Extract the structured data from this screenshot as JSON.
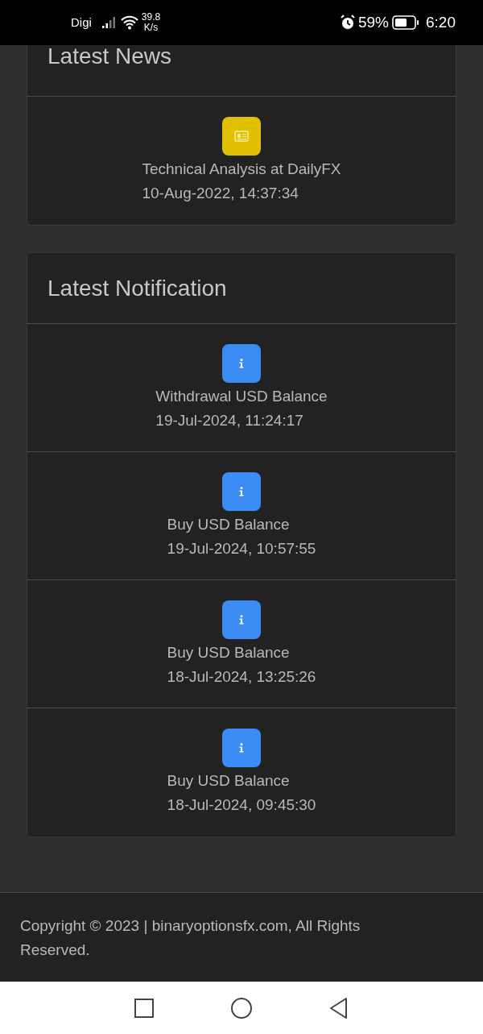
{
  "status_bar": {
    "carrier": "Digi",
    "speed_value": "39.8",
    "speed_unit": "K/s",
    "battery": "59%",
    "time": "6:20"
  },
  "sections": [
    {
      "title": "Latest News",
      "cut_top": true,
      "items": [
        {
          "kind": "news",
          "title": "Technical Analysis at DailyFX",
          "date": "10-Aug-2022, 14:37:34"
        }
      ]
    },
    {
      "title": "Latest Notification",
      "cut_top": false,
      "items": [
        {
          "kind": "info",
          "title": "Withdrawal USD Balance",
          "date": "19-Jul-2024, 11:24:17"
        },
        {
          "kind": "info",
          "title": "Buy USD Balance",
          "date": "19-Jul-2024, 10:57:55"
        },
        {
          "kind": "info",
          "title": "Buy USD Balance",
          "date": "18-Jul-2024, 13:25:26"
        },
        {
          "kind": "info",
          "title": "Buy USD Balance",
          "date": "18-Jul-2024, 09:45:30"
        }
      ]
    }
  ],
  "footer": "Copyright © 2023 | binaryoptionsfx.com, All Rights Reserved."
}
